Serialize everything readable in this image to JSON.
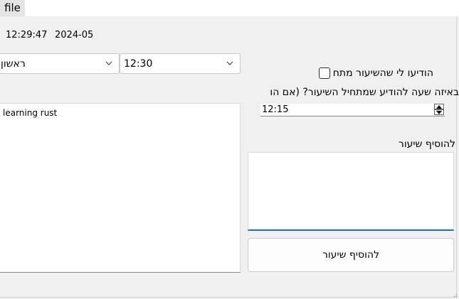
{
  "menu": {
    "file_label": "file"
  },
  "clock": {
    "time": "12:29:47",
    "date": "2024-05-"
  },
  "day_select": {
    "value": "ראשון"
  },
  "time_select": {
    "value": "12:30"
  },
  "notify": {
    "label": "הודיעו לי שהשיעור מתחל",
    "checked": false
  },
  "question": {
    "label": "באיזה שעה להודיע שמתחיל השיעור? (אם הו"
  },
  "notify_time": {
    "value": "12:15"
  },
  "lessons": {
    "items": [
      "learning rust"
    ]
  },
  "add_lesson": {
    "label": "להוסיף שיעור",
    "button_label": "להוסיף שיעור"
  },
  "colors": {
    "accent": "#1f6fbf",
    "background": "#f0f0f0"
  }
}
